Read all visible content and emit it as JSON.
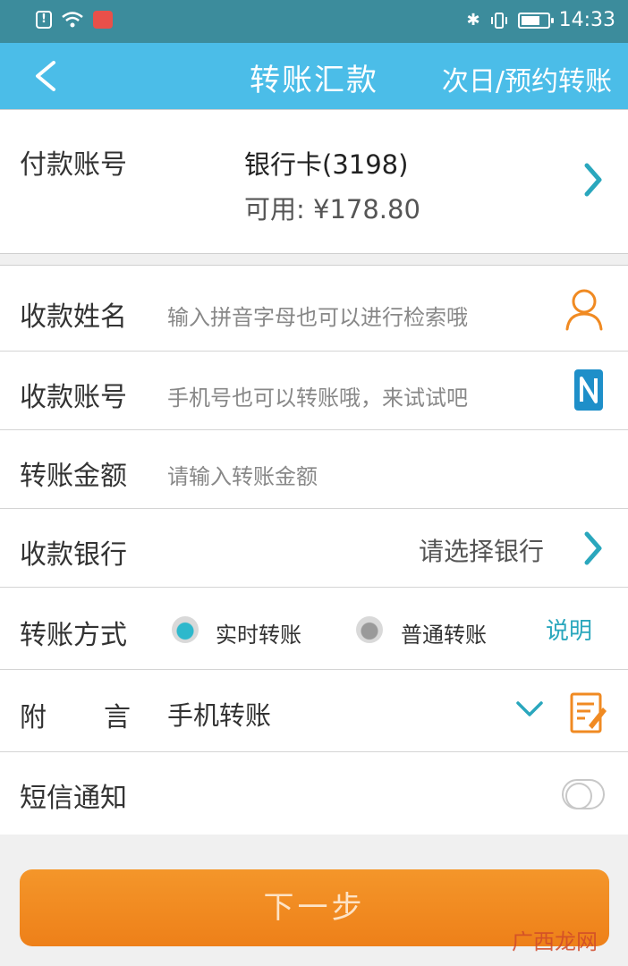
{
  "status_bar": {
    "time": "14:33",
    "bluetooth_icon": "bluetooth-icon",
    "battery_icon": "battery-icon"
  },
  "header": {
    "title": "转账汇款",
    "action": "次日/预约转账",
    "back_icon": "chevron-left-icon"
  },
  "payer": {
    "label": "付款账号",
    "account": "银行卡(3198)",
    "available": "可用: ¥178.80"
  },
  "form": {
    "payee_name": {
      "label": "收款姓名",
      "placeholder": "输入拼音字母也可以进行检索哦",
      "icon": "contact-person-icon"
    },
    "payee_account": {
      "label": "收款账号",
      "placeholder": "手机号也可以转账哦，来试试吧",
      "icon": "nfc-icon"
    },
    "amount": {
      "label": "转账金额",
      "placeholder": "请输入转账金额"
    },
    "bank": {
      "label": "收款银行",
      "value": "请选择银行"
    },
    "method": {
      "label": "转账方式",
      "option_realtime": "实时转账",
      "option_normal": "普通转账",
      "selected": "实时转账",
      "help": "说明"
    },
    "remark": {
      "label_a": "附",
      "label_b": "言",
      "value": "手机转账",
      "icon": "edit-note-icon"
    },
    "sms": {
      "label": "短信通知",
      "enabled": false
    }
  },
  "next_button": "下一步",
  "watermark": "广西龙网",
  "colors": {
    "status_bar": "#3c8c9c",
    "title_bar": "#4bbde8",
    "accent_teal": "#2aa7bd",
    "accent_orange": "#f08a22"
  }
}
